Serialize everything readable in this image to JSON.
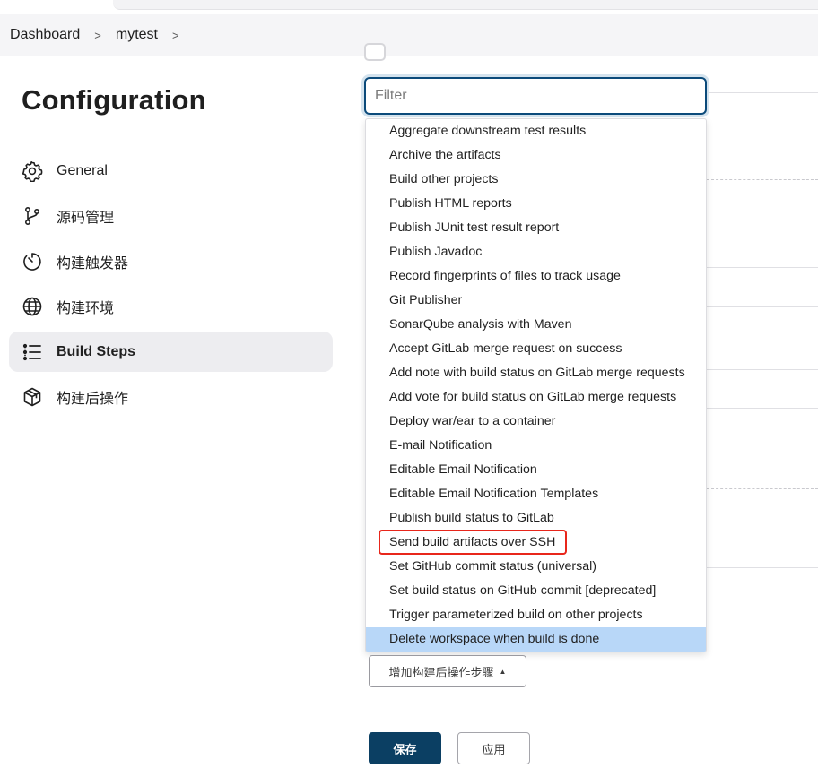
{
  "breadcrumb": {
    "items": [
      "Dashboard",
      "mytest"
    ],
    "separator": ">"
  },
  "sidebar": {
    "title": "Configuration",
    "items": [
      {
        "label": "General",
        "icon": "gear-icon",
        "active": false
      },
      {
        "label": "源码管理",
        "icon": "branch-icon",
        "active": false
      },
      {
        "label": "构建触发器",
        "icon": "timer-icon",
        "active": false
      },
      {
        "label": "构建环境",
        "icon": "globe-icon",
        "active": false
      },
      {
        "label": "Build Steps",
        "icon": "list-icon",
        "active": true
      },
      {
        "label": "构建后操作",
        "icon": "package-icon",
        "active": false
      }
    ]
  },
  "filter": {
    "placeholder": "Filter"
  },
  "menu": {
    "items": [
      "Aggregate downstream test results",
      "Archive the artifacts",
      "Build other projects",
      "Publish HTML reports",
      "Publish JUnit test result report",
      "Publish Javadoc",
      "Record fingerprints of files to track usage",
      "Git Publisher",
      "SonarQube analysis with Maven",
      "Accept GitLab merge request on success",
      "Add note with build status on GitLab merge requests",
      "Add vote for build status on GitLab merge requests",
      "Deploy war/ear to a container",
      "E-mail Notification",
      "Editable Email Notification",
      "Editable Email Notification Templates",
      "Publish build status to GitLab",
      "Send build artifacts over SSH",
      "Set GitHub commit status (universal)",
      "Set build status on GitHub commit [deprecated]",
      "Trigger parameterized build on other projects",
      "Delete workspace when build is done"
    ],
    "highlighted_item": "Send build artifacts over SSH",
    "hovered_item": "Delete workspace when build is done"
  },
  "actions": {
    "add_post_build_label": "增加构建后操作步骤",
    "save_label": "保存",
    "apply_label": "应用"
  },
  "colors": {
    "accent": "#0b3f63",
    "highlight_border": "#e8261b",
    "menu_hover": "#b8d7f8",
    "active_nav_bg": "#ededf0"
  }
}
